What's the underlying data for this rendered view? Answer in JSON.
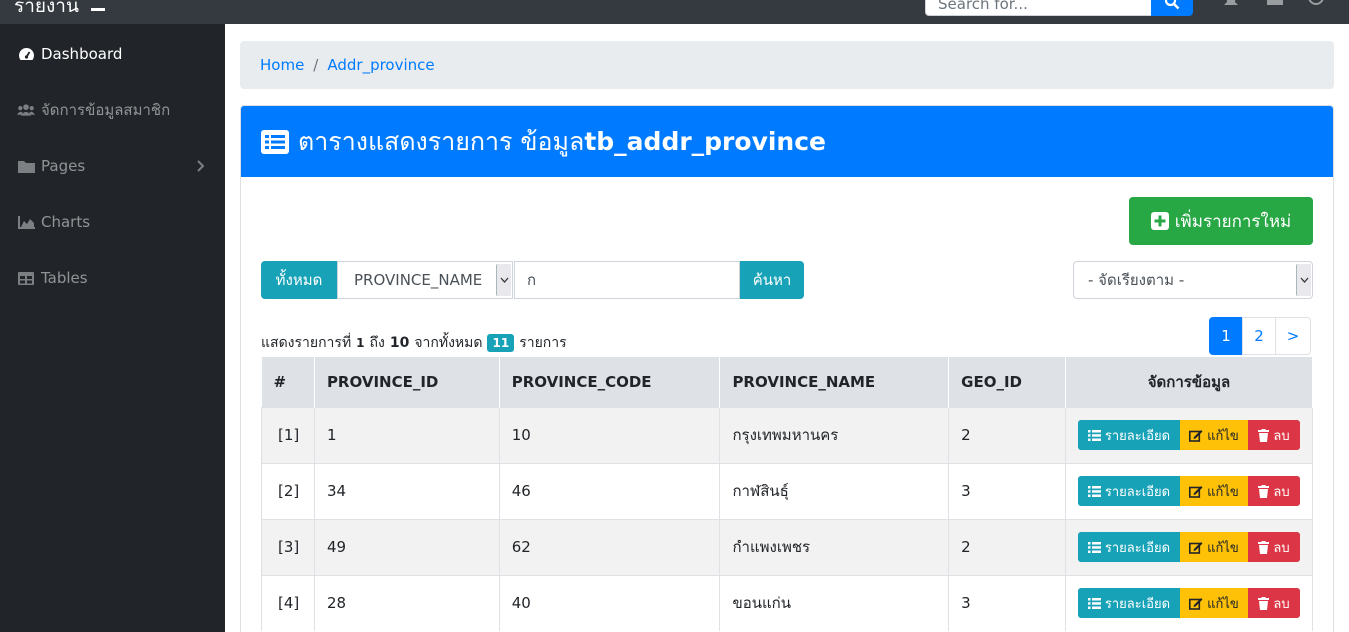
{
  "navbar": {
    "brand": "รายงาน",
    "search_placeholder": "Search for..."
  },
  "sidebar": {
    "items": [
      {
        "label": "Dashboard",
        "icon": "tachometer-icon"
      },
      {
        "label": "จัดการข้อมูลสมาชิก",
        "icon": "users-icon"
      },
      {
        "label": "Pages",
        "icon": "folder-icon"
      },
      {
        "label": "Charts",
        "icon": "area-chart-icon"
      },
      {
        "label": "Tables",
        "icon": "table-icon"
      }
    ]
  },
  "breadcrumb": {
    "home": "Home",
    "current": "Addr_province"
  },
  "card": {
    "title_prefix": "ตารางแสดงรายการ ข้อมูล",
    "title_table": "tb_addr_province",
    "add_button": "เพิ่มรายการใหม่"
  },
  "filter": {
    "all_button": "ทั้งหมด",
    "field_selected": "PROVINCE_NAME",
    "keyword": "ก",
    "search_button": "ค้นหา",
    "sort_selected": "- จัดเรียงตาม -"
  },
  "summary": {
    "prefix": "แสดงรายการที่",
    "from": "1",
    "to_label": "ถึง",
    "to": "10",
    "total_label": "จากทั้งหมด",
    "total": "11",
    "suffix": "รายการ"
  },
  "pagination": [
    "1",
    "2",
    ">"
  ],
  "table": {
    "headers": [
      "#",
      "PROVINCE_ID",
      "PROVINCE_CODE",
      "PROVINCE_NAME",
      "GEO_ID",
      "จัดการข้อมูล"
    ],
    "rows": [
      {
        "no": "[1]",
        "id": "1",
        "code": "10",
        "name": "กรุงเทพมหานคร",
        "geo": "2"
      },
      {
        "no": "[2]",
        "id": "34",
        "code": "46",
        "name": "กาฬสินธุ์",
        "geo": "3"
      },
      {
        "no": "[3]",
        "id": "49",
        "code": "62",
        "name": "กำแพงเพชร",
        "geo": "2"
      },
      {
        "no": "[4]",
        "id": "28",
        "code": "40",
        "name": "ขอนแก่น",
        "geo": "3"
      }
    ],
    "actions": {
      "detail": "รายละเอียด",
      "edit": "แก้ไข",
      "delete": "ลบ"
    }
  },
  "colors": {
    "navbar": "#343a40",
    "sidebar": "#212529",
    "primary": "#007bff",
    "success": "#28a745",
    "info": "#17a2b8",
    "warning": "#ffc107",
    "danger": "#dc3545"
  }
}
